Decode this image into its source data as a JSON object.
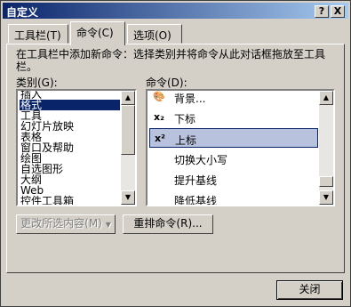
{
  "window": {
    "title": "自定义",
    "help_button": "?",
    "close_button": "X"
  },
  "tabs": [
    {
      "label": "工具栏(T)"
    },
    {
      "label": "命令(C)"
    },
    {
      "label": "选项(O)"
    }
  ],
  "instructions": "在工具栏中添加新命令：选择类别并将命令从此对话框拖放至工具栏。",
  "categories": {
    "label": "类别(G):",
    "items": [
      "插入",
      "格式",
      "工具",
      "幻灯片放映",
      "表格",
      "窗口及帮助",
      "绘图",
      "自选图形",
      "大纲",
      "Web",
      "控件工具箱"
    ],
    "selected": "格式"
  },
  "commands": {
    "label": "命令(D):",
    "items": [
      {
        "icon": "background-icon",
        "label": "背景..."
      },
      {
        "icon": "subscript-icon",
        "label": "下标"
      },
      {
        "icon": "superscript-icon",
        "label": "上标"
      },
      {
        "icon": "none",
        "label": "切换大小写"
      },
      {
        "icon": "none",
        "label": "提升基线"
      },
      {
        "icon": "none",
        "label": "降低基线"
      }
    ],
    "selected": "上标"
  },
  "buttons": {
    "modify_selection": "更改所选内容(M)",
    "rearrange": "重排命令(R)...",
    "close": "关闭"
  },
  "colors": {
    "title_bar": "#0a246a",
    "selection": "#0a246a",
    "dialog_face": "#d4d0c8"
  }
}
